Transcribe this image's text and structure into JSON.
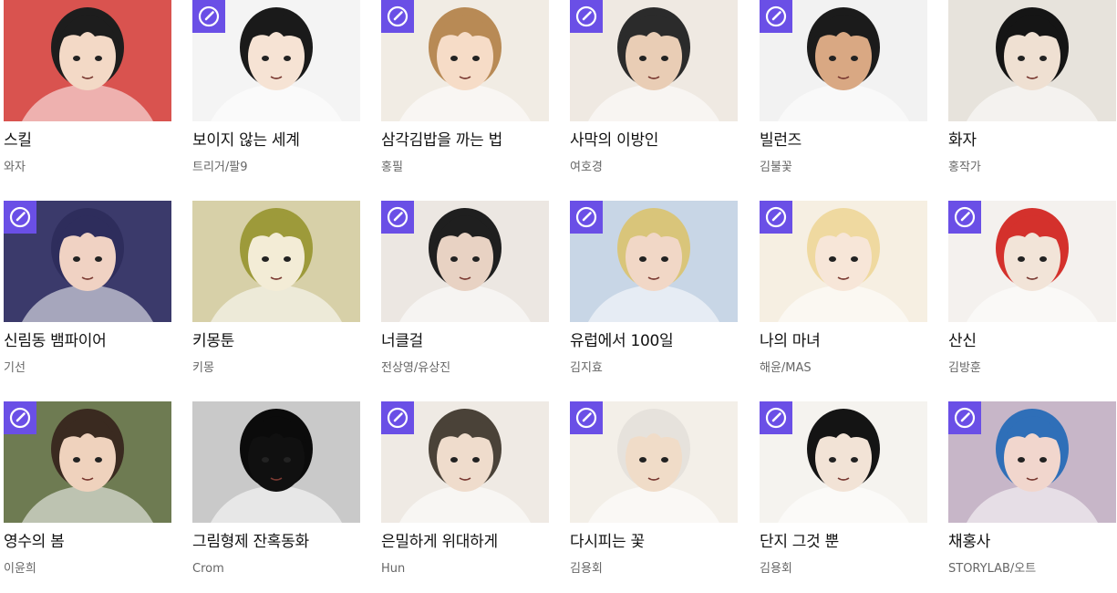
{
  "badge_color": "#6a4fe6",
  "badge_icon": "clock-icon",
  "rows": [
    [
      {
        "title": "스킬",
        "author": "와자",
        "badge": false,
        "bg": "#d9534f",
        "skin": "#f3d9c6",
        "hair": "#1d1d1d"
      },
      {
        "title": "보이지 않는 세계",
        "author": "트리거/팔9",
        "badge": true,
        "bg": "#f4f4f4",
        "skin": "#f6e3d4",
        "hair": "#1a1a1a"
      },
      {
        "title": "삼각김밥을 까는 법",
        "author": "홍필",
        "badge": true,
        "bg": "#f1ece4",
        "skin": "#f6dcc7",
        "hair": "#b88a55"
      },
      {
        "title": "사막의 이방인",
        "author": "여호경",
        "badge": true,
        "bg": "#efe9e2",
        "skin": "#e9cdb5",
        "hair": "#2b2b2b"
      },
      {
        "title": "빌런즈",
        "author": "김불꽃",
        "badge": true,
        "bg": "#f2f2f2",
        "skin": "#d9a883",
        "hair": "#1b1b1b"
      },
      {
        "title": "화자",
        "author": "홍작가",
        "badge": false,
        "bg": "#e7e3dc",
        "skin": "#efe0d2",
        "hair": "#151515"
      }
    ],
    [
      {
        "title": "신림동 뱀파이어",
        "author": "기선",
        "badge": true,
        "bg": "#3b3a6b",
        "skin": "#f0d2c3",
        "hair": "#2e2d5c"
      },
      {
        "title": "키몽툰",
        "author": "키몽",
        "badge": false,
        "bg": "#d7d0a8",
        "skin": "#f3ecd6",
        "hair": "#9d9a3a"
      },
      {
        "title": "너클걸",
        "author": "전상영/유상진",
        "badge": true,
        "bg": "#ece7e2",
        "skin": "#e8d2c3",
        "hair": "#1f1f1f"
      },
      {
        "title": "유럽에서 100일",
        "author": "김지효",
        "badge": true,
        "bg": "#c8d6e6",
        "skin": "#f1d7c6",
        "hair": "#d9c57a"
      },
      {
        "title": "나의 마녀",
        "author": "해윤/MAS",
        "badge": true,
        "bg": "#f6efe2",
        "skin": "#f7e6d8",
        "hair": "#efd9a0"
      },
      {
        "title": "산신",
        "author": "김방훈",
        "badge": true,
        "bg": "#f4f1ee",
        "skin": "#f2e4d8",
        "hair": "#d4312c"
      }
    ],
    [
      {
        "title": "영수의 봄",
        "author": "이윤희",
        "badge": true,
        "bg": "#6e7b52",
        "skin": "#efd2bd",
        "hair": "#3a2a20"
      },
      {
        "title": "그림형제 잔혹동화",
        "author": "Crom",
        "badge": false,
        "bg": "#c9c9c9",
        "skin": "#101010",
        "hair": "#0b0b0b"
      },
      {
        "title": "은밀하게 위대하게",
        "author": "Hun",
        "badge": true,
        "bg": "#efeae4",
        "skin": "#efdccc",
        "hair": "#4a4238"
      },
      {
        "title": "다시피는 꽃",
        "author": "김용회",
        "badge": true,
        "bg": "#f3efe8",
        "skin": "#f0dcc8",
        "hair": "#e6e2dc"
      },
      {
        "title": "단지 그것 뿐",
        "author": "김용회",
        "badge": true,
        "bg": "#f5f3ef",
        "skin": "#f2e3d6",
        "hair": "#141414"
      },
      {
        "title": "채홍사",
        "author": "STORYLAB/오트",
        "badge": true,
        "bg": "#c7b6c8",
        "skin": "#f1d6cd",
        "hair": "#2f6fb8"
      }
    ]
  ]
}
